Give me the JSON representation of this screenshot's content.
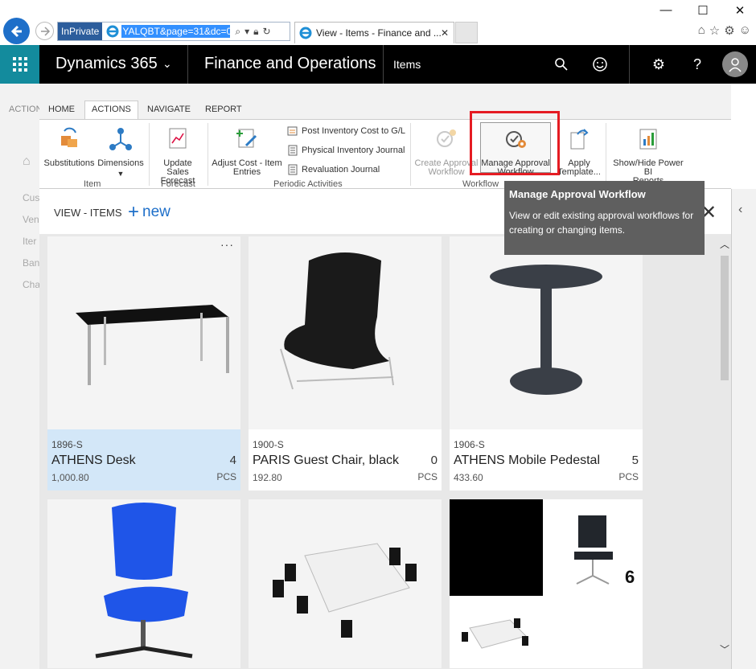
{
  "browser": {
    "inprivate": "InPrivate",
    "url": "YALQBT&page=31&dc=0",
    "tab_title": "View - Items - Finance and ..."
  },
  "appbar": {
    "brand": "Dynamics 365",
    "module": "Finance and Operations",
    "crumb": "Items"
  },
  "left_rail": {
    "actions": "ACTION",
    "items": [
      "Cus",
      "Ven",
      "Iter",
      "Ban",
      "Cha"
    ]
  },
  "ribbon": {
    "tabs": [
      "HOME",
      "ACTIONS",
      "NAVIGATE",
      "REPORT"
    ],
    "buttons": {
      "substitutions": "Substitutions",
      "dimensions": "Dimensions",
      "update_sales_forecast_1": "Update Sales",
      "update_sales_forecast_2": "Forecast",
      "adjust_cost_1": "Adjust Cost - Item",
      "adjust_cost_2": "Entries",
      "post_inventory": "Post Inventory Cost to G/L",
      "physical_inventory": "Physical Inventory Journal",
      "revaluation": "Revaluation Journal",
      "create_approval_1": "Create Approval",
      "create_approval_2": "Workflow",
      "manage_approval_1": "Manage Approval",
      "manage_approval_2": "Workflow",
      "apply_template_1": "Apply",
      "apply_template_2": "Template...",
      "powerbi_1": "Show/Hide Power BI",
      "powerbi_2": "Reports"
    },
    "groups": {
      "item": "Item",
      "forecast": "Forecast",
      "periodic": "Periodic Activities",
      "workflow": "Workflow"
    }
  },
  "tooltip": {
    "title": "Manage Approval Workflow",
    "body": "View or edit existing approval workflows for creating or changing items."
  },
  "view": {
    "title": "VIEW - ITEMS",
    "new_label": "new"
  },
  "items": [
    {
      "sku": "1896-S",
      "name": "ATHENS Desk",
      "qty": "4",
      "price": "1,000.80",
      "unit": "PCS"
    },
    {
      "sku": "1900-S",
      "name": "PARIS Guest Chair, black",
      "qty": "0",
      "price": "192.80",
      "unit": "PCS"
    },
    {
      "sku": "1906-S",
      "name": "ATHENS Mobile Pedestal",
      "qty": "5",
      "price": "433.60",
      "unit": "PCS"
    }
  ],
  "tile_badge": "6",
  "colors": {
    "accent": "#1e6fc9",
    "waffle": "#138b9d",
    "highlight": "#e51c23"
  }
}
